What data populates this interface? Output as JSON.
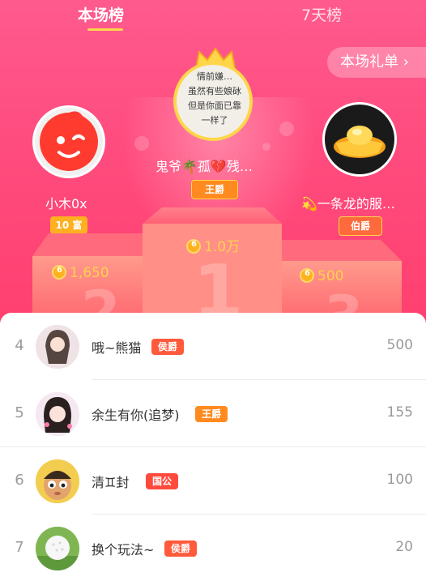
{
  "tabs": [
    {
      "label": "本场榜",
      "active": true
    },
    {
      "label": "7天榜",
      "active": false
    }
  ],
  "gift_list_button": "本场礼单 ›",
  "podium": {
    "first": {
      "name": "鬼爷🌴孤💔残…",
      "badge": "王爵",
      "score": "1.0万",
      "avatar_text": "情前嫌…\n虽然有些娘砅\n但是你面已靠\n一样了",
      "place": "1"
    },
    "second": {
      "name": "小木0x",
      "badge": "10 富",
      "score": "1,650",
      "place": "2"
    },
    "third": {
      "name": "💫一条龙的服…",
      "badge": "伯爵",
      "score": "500",
      "place": "3"
    }
  },
  "ranking": [
    {
      "rank": "4",
      "name": "哦~熊猫",
      "badge": "侯爵",
      "value": "500"
    },
    {
      "rank": "5",
      "name": "余生有你(追梦)",
      "badge": "王爵",
      "value": "155"
    },
    {
      "rank": "6",
      "name": "清♊封",
      "badge": "国公",
      "value": "100"
    },
    {
      "rank": "7",
      "name": "换个玩法~",
      "badge": "侯爵",
      "value": "20"
    }
  ],
  "colors": {
    "accent": "#ffd64a",
    "badge_king": "#ff8a1f",
    "badge_marquis": "#ff5a3c",
    "badge_duke": "#ff4a3c",
    "coin": "#ffb21f"
  }
}
